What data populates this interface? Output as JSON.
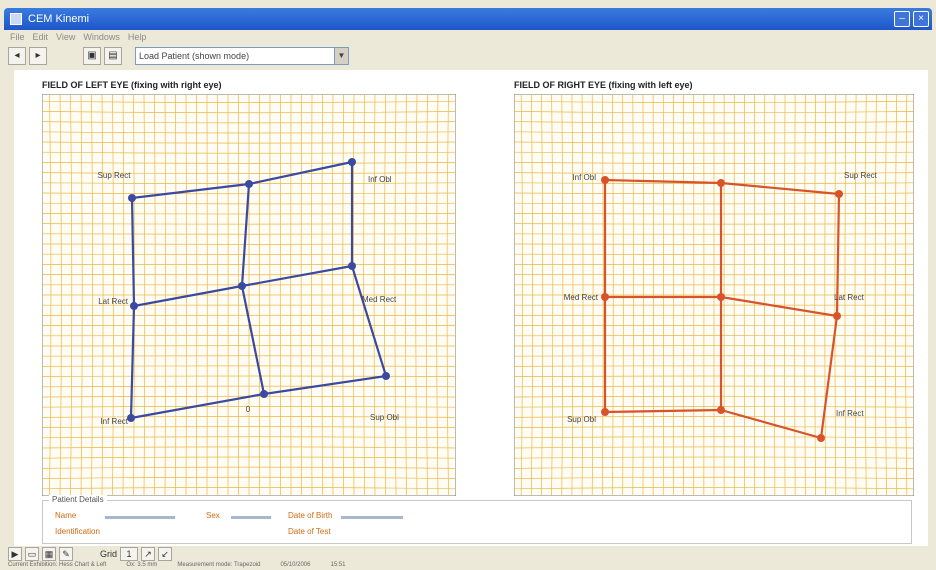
{
  "window": {
    "title": "CEM Kinemi"
  },
  "menu": [
    "File",
    "Edit",
    "View",
    "Windows",
    "Help"
  ],
  "toolbar": {
    "select_value": "Load Patient (shown mode)"
  },
  "left_panel": {
    "title": "FIELD OF LEFT EYE (fixing with right eye)",
    "points": [
      {
        "name": "Sup Rect",
        "label_anchor": "top-left"
      },
      {
        "name": "Inf Obl",
        "label_anchor": "top-right"
      },
      {
        "name": "Lat Rect",
        "label_anchor": "left"
      },
      {
        "name": "Med Rect",
        "label_anchor": "right"
      },
      {
        "name": "Inf Rect",
        "label_anchor": "bottom-left"
      },
      {
        "name": "Sup Obl",
        "label_anchor": "bottom-right"
      }
    ],
    "center_label": "0"
  },
  "right_panel": {
    "title": "FIELD OF RIGHT EYE (fixing with left eye)",
    "points": [
      {
        "name": "Inf Obl",
        "label_anchor": "top-left"
      },
      {
        "name": "Sup Rect",
        "label_anchor": "top-right"
      },
      {
        "name": "Med Rect",
        "label_anchor": "left"
      },
      {
        "name": "Lat Rect",
        "label_anchor": "right"
      },
      {
        "name": "Sup Obl",
        "label_anchor": "bottom-left"
      },
      {
        "name": "Inf Rect",
        "label_anchor": "bottom-right"
      }
    ]
  },
  "patient_details": {
    "legend": "Patient Details",
    "name_label": "Name",
    "id_label": "Identification",
    "sex_label": "Sex",
    "birth_label": "Date of Birth",
    "test_label": "Date of Test"
  },
  "bottom_toolbar": {
    "grid_label": "Grid",
    "zoom_value": "1"
  },
  "statusbar": [
    "Current Exhibition: Hess Chart & Left",
    "Ox: 3.5 mm",
    "Measurement mode: Trapezoid",
    "05/10/2006",
    "15:51"
  ],
  "colors": {
    "grid": "#e8b84a",
    "left_plot": "#3b4aa0",
    "right_plot": "#d9532a",
    "label": "#444444"
  }
}
